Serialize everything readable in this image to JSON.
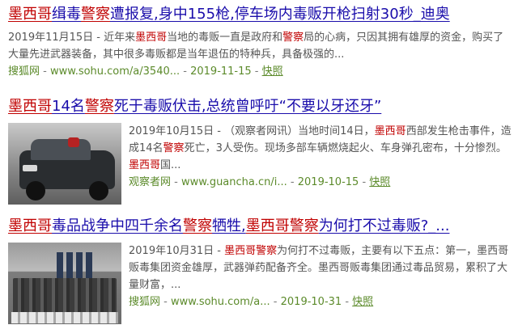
{
  "results": [
    {
      "title": [
        {
          "t": "墨西哥",
          "hl": true
        },
        {
          "t": "缉毒",
          "hl": false
        },
        {
          "t": "警察",
          "hl": true
        },
        {
          "t": "遭报复,身中155枪,停车场内毒贩开枪扫射30秒_迪奥",
          "hl": false
        }
      ],
      "abstract": [
        {
          "t": "2019年11月15日 - 近年来",
          "hl": false
        },
        {
          "t": "墨西哥",
          "hl": true
        },
        {
          "t": "当地的毒贩一直是政府和",
          "hl": false
        },
        {
          "t": "警察",
          "hl": true
        },
        {
          "t": "局的心病，只因其拥有雄厚的资金，购买了大量先进武器装备，其中很多毒贩都是当年退伍的特种兵，具备极强的...",
          "hl": false
        }
      ],
      "source": "搜狐网",
      "url": "www.sohu.com/a/3540...",
      "date": "2019-11-15",
      "snapshot": "快照"
    },
    {
      "title": [
        {
          "t": "墨西哥",
          "hl": true
        },
        {
          "t": "14名",
          "hl": false
        },
        {
          "t": "警察",
          "hl": true
        },
        {
          "t": "死于毒贩伏击,总统曾呼吁“不要以牙还牙”",
          "hl": false
        }
      ],
      "abstract": [
        {
          "t": "2019年10月15日 - （观察者网讯）当地时间14日，",
          "hl": false
        },
        {
          "t": "墨西哥",
          "hl": true
        },
        {
          "t": "西部发生枪击事件，造成14名",
          "hl": false
        },
        {
          "t": "警察",
          "hl": true
        },
        {
          "t": "死亡，3人受伤。现场多部车辆燃烧起火、车身弹孔密布，十分惨烈。",
          "hl": false
        },
        {
          "t": "墨西哥",
          "hl": true
        },
        {
          "t": "国...",
          "hl": false
        }
      ],
      "source": "观察者网",
      "url": "www.guancha.cn/i...",
      "date": "2019-10-15",
      "snapshot": "快照"
    },
    {
      "title": [
        {
          "t": "墨西哥",
          "hl": true
        },
        {
          "t": "毒品战争中四千余名",
          "hl": false
        },
        {
          "t": "警察",
          "hl": true
        },
        {
          "t": "牺牲,",
          "hl": false
        },
        {
          "t": "墨西哥警察",
          "hl": true
        },
        {
          "t": "为何打不过毒贩?_...",
          "hl": false
        }
      ],
      "abstract": [
        {
          "t": "2019年10月31日 - ",
          "hl": false
        },
        {
          "t": "墨西哥警察",
          "hl": true
        },
        {
          "t": "为何打不过毒贩，主要有以下五点：第一，墨西哥贩毒集团资金雄厚，武器弹药配备齐全。墨西哥贩毒集团通过毒品贸易，累积了大量财富，...",
          "hl": false
        }
      ],
      "source": "搜狐网",
      "url": "www.sohu.com/a...",
      "date": "2019-10-31",
      "snapshot": "快照"
    }
  ]
}
